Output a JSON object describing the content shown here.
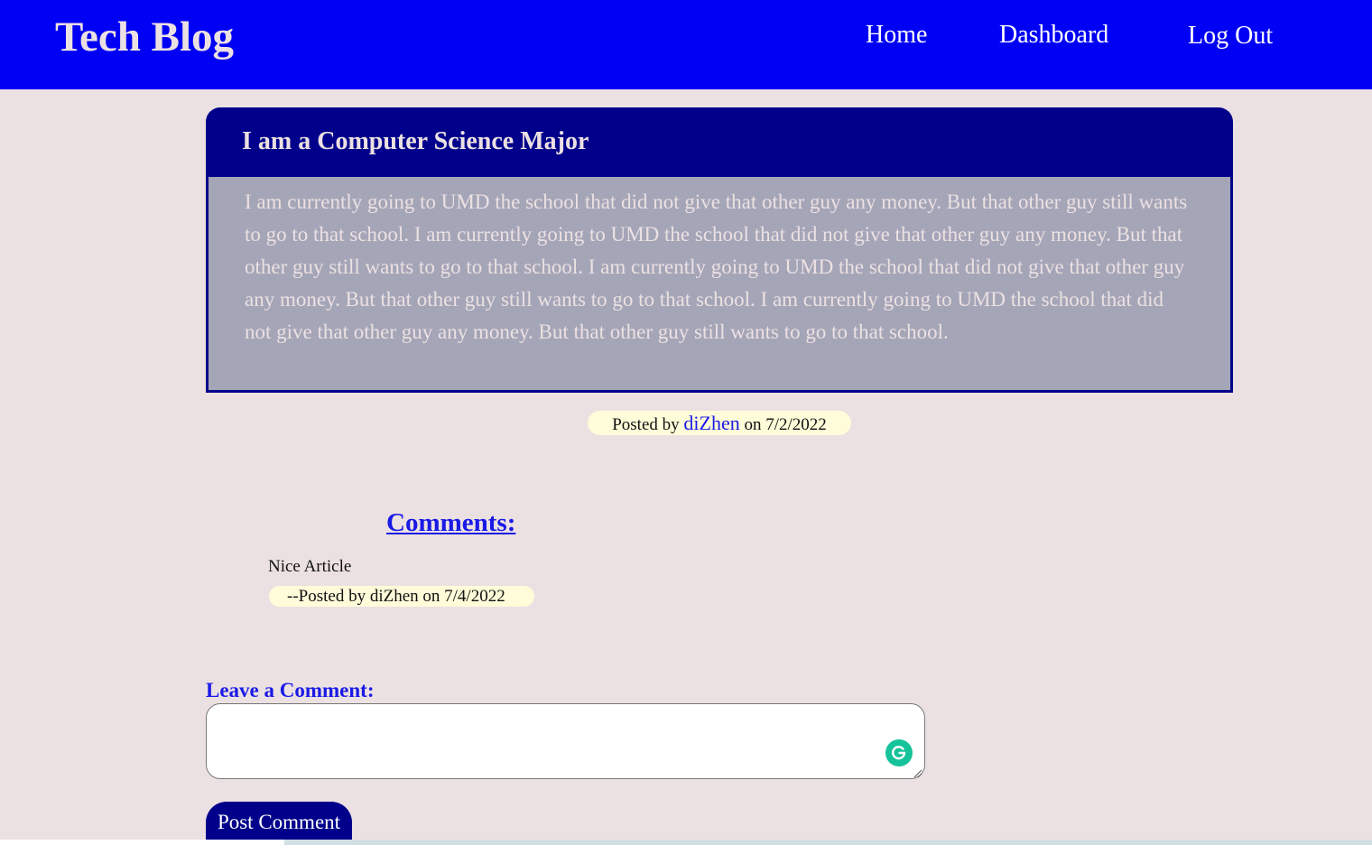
{
  "navbar": {
    "title": "Tech Blog",
    "links": [
      "Home",
      "Dashboard",
      "Log Out"
    ],
    "background": "#0000f5"
  },
  "post": {
    "title": "I am a Computer Science Major",
    "content": "I am currently going to UMD the school that did not give that other guy any money. But that other guy still wants to go to that school. I am currently going to UMD the school that did not give that other guy any money. But that other guy still wants to go to that school. I am currently going to UMD the school that did not give that other guy any money. But that other guy still wants to go to that school. I am currently going to UMD the school that did not give that other guy any money. But that other guy still wants to go to that school.",
    "posted_by_prefix": "Posted by",
    "author": "diZhen",
    "date_prefix": "on",
    "date": "7/2/2022"
  },
  "comments": {
    "heading": "Comments:",
    "items": [
      {
        "text": "Nice Article",
        "meta": "--Posted by diZhen on 7/4/2022"
      }
    ]
  },
  "comment_form": {
    "label": "Leave a Comment:",
    "value": "",
    "submit_label": "Post Comment"
  },
  "icons": {
    "grammarly": "grammarly-icon",
    "resize": "resize-handle-icon"
  },
  "colors": {
    "page_background": "#ece1e2",
    "post_header": "#00008b",
    "post_body": "#a5a5b8",
    "meta_badge": "#fefcd9",
    "link": "#1a1ae6",
    "button": "#00008b"
  }
}
